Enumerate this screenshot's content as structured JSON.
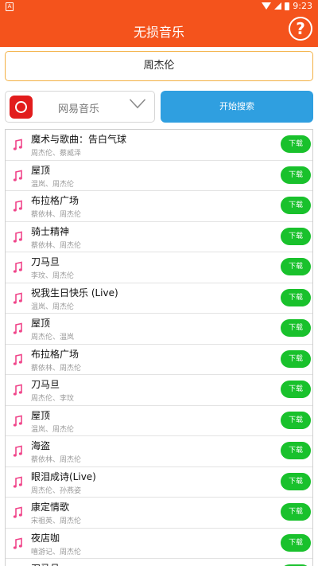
{
  "statusbar": {
    "time": "9:23"
  },
  "appbar": {
    "title": "无损音乐",
    "help_label": "?"
  },
  "search": {
    "query": "周杰伦"
  },
  "source": {
    "selected": "网易音乐"
  },
  "start_search_label": "开始搜索",
  "download_label": "下载",
  "songs": [
    {
      "title": "魔术与歌曲：告白气球",
      "artist": "周杰伦、蔡威泽"
    },
    {
      "title": "屋顶",
      "artist": "温岚、周杰伦"
    },
    {
      "title": "布拉格广场",
      "artist": "蔡依林、周杰伦"
    },
    {
      "title": "骑士精神",
      "artist": "蔡依林、周杰伦"
    },
    {
      "title": "刀马旦",
      "artist": "李玟、周杰伦"
    },
    {
      "title": "祝我生日快乐 (Live)",
      "artist": "温岚、周杰伦"
    },
    {
      "title": "屋顶",
      "artist": "周杰伦、温岚"
    },
    {
      "title": "布拉格广场",
      "artist": "蔡依林、周杰伦"
    },
    {
      "title": "刀马旦",
      "artist": "周杰伦、李玟"
    },
    {
      "title": "屋顶",
      "artist": "温岚、周杰伦"
    },
    {
      "title": "海盗",
      "artist": "蔡依林、周杰伦"
    },
    {
      "title": "眼泪成诗(Live)",
      "artist": "周杰伦、孙燕姿"
    },
    {
      "title": "康定情歌",
      "artist": "宋祖英、周杰伦"
    },
    {
      "title": "夜店咖",
      "artist": "嘻游记、周杰伦"
    },
    {
      "title": "刀马旦",
      "artist": ""
    }
  ]
}
